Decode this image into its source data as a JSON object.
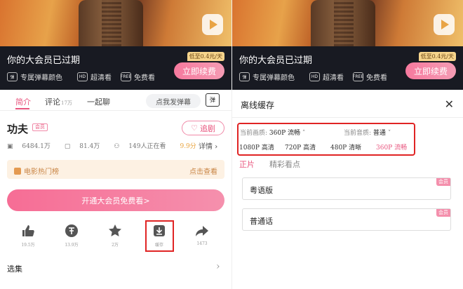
{
  "hero": {
    "vip_expired": "你的大会员已过期",
    "price_tag": "低至0.4元/天",
    "renew_button": "立即续费",
    "features": [
      "专属弹幕颜色",
      "超清看",
      "免费看"
    ],
    "feature_icons": [
      "弹",
      "HD",
      "FREE"
    ]
  },
  "tabs": {
    "intro": "简介",
    "comments": "评论",
    "comments_count": "17万",
    "watch_together": "一起聊",
    "danmu_placeholder": "点我发弹幕",
    "danmu_icon": "弹"
  },
  "video": {
    "title": "功夫",
    "vip_badge": "会员",
    "follow_button": "追剧",
    "plays": "6484.1万",
    "danmu_count": "81.4万",
    "watching": "149人正在看",
    "score": "9.9分",
    "detail": "详情"
  },
  "rank": {
    "label": "电影热门榜",
    "view": "点击查看"
  },
  "open_vip_button": "开通大会员免费看>",
  "actions": [
    {
      "icon": "thumbs-up-icon",
      "label": "19.5万"
    },
    {
      "icon": "coin-icon",
      "label": "13.9万"
    },
    {
      "icon": "star-icon",
      "label": "2万"
    },
    {
      "icon": "download-icon",
      "label": "缓存"
    },
    {
      "icon": "share-icon",
      "label": "1473"
    }
  ],
  "episodes_label": "选集",
  "offline": {
    "title": "离线缓存",
    "quality_label": "当前画质:",
    "quality_value": "360P 流畅",
    "audio_label": "当前音质:",
    "audio_value": "普通",
    "quality_options": [
      "1080P 高清",
      "720P 高清",
      "480P 清晰",
      "360P 流畅"
    ],
    "sub_tabs": [
      "正片",
      "精彩看点"
    ],
    "episodes": [
      {
        "label": "粤语版",
        "badge": "会员"
      },
      {
        "label": "普通话",
        "badge": "会员"
      }
    ]
  },
  "colors": {
    "accent": "#e8557e",
    "highlight_box": "#e02424",
    "vip_dark": "#181a22"
  }
}
